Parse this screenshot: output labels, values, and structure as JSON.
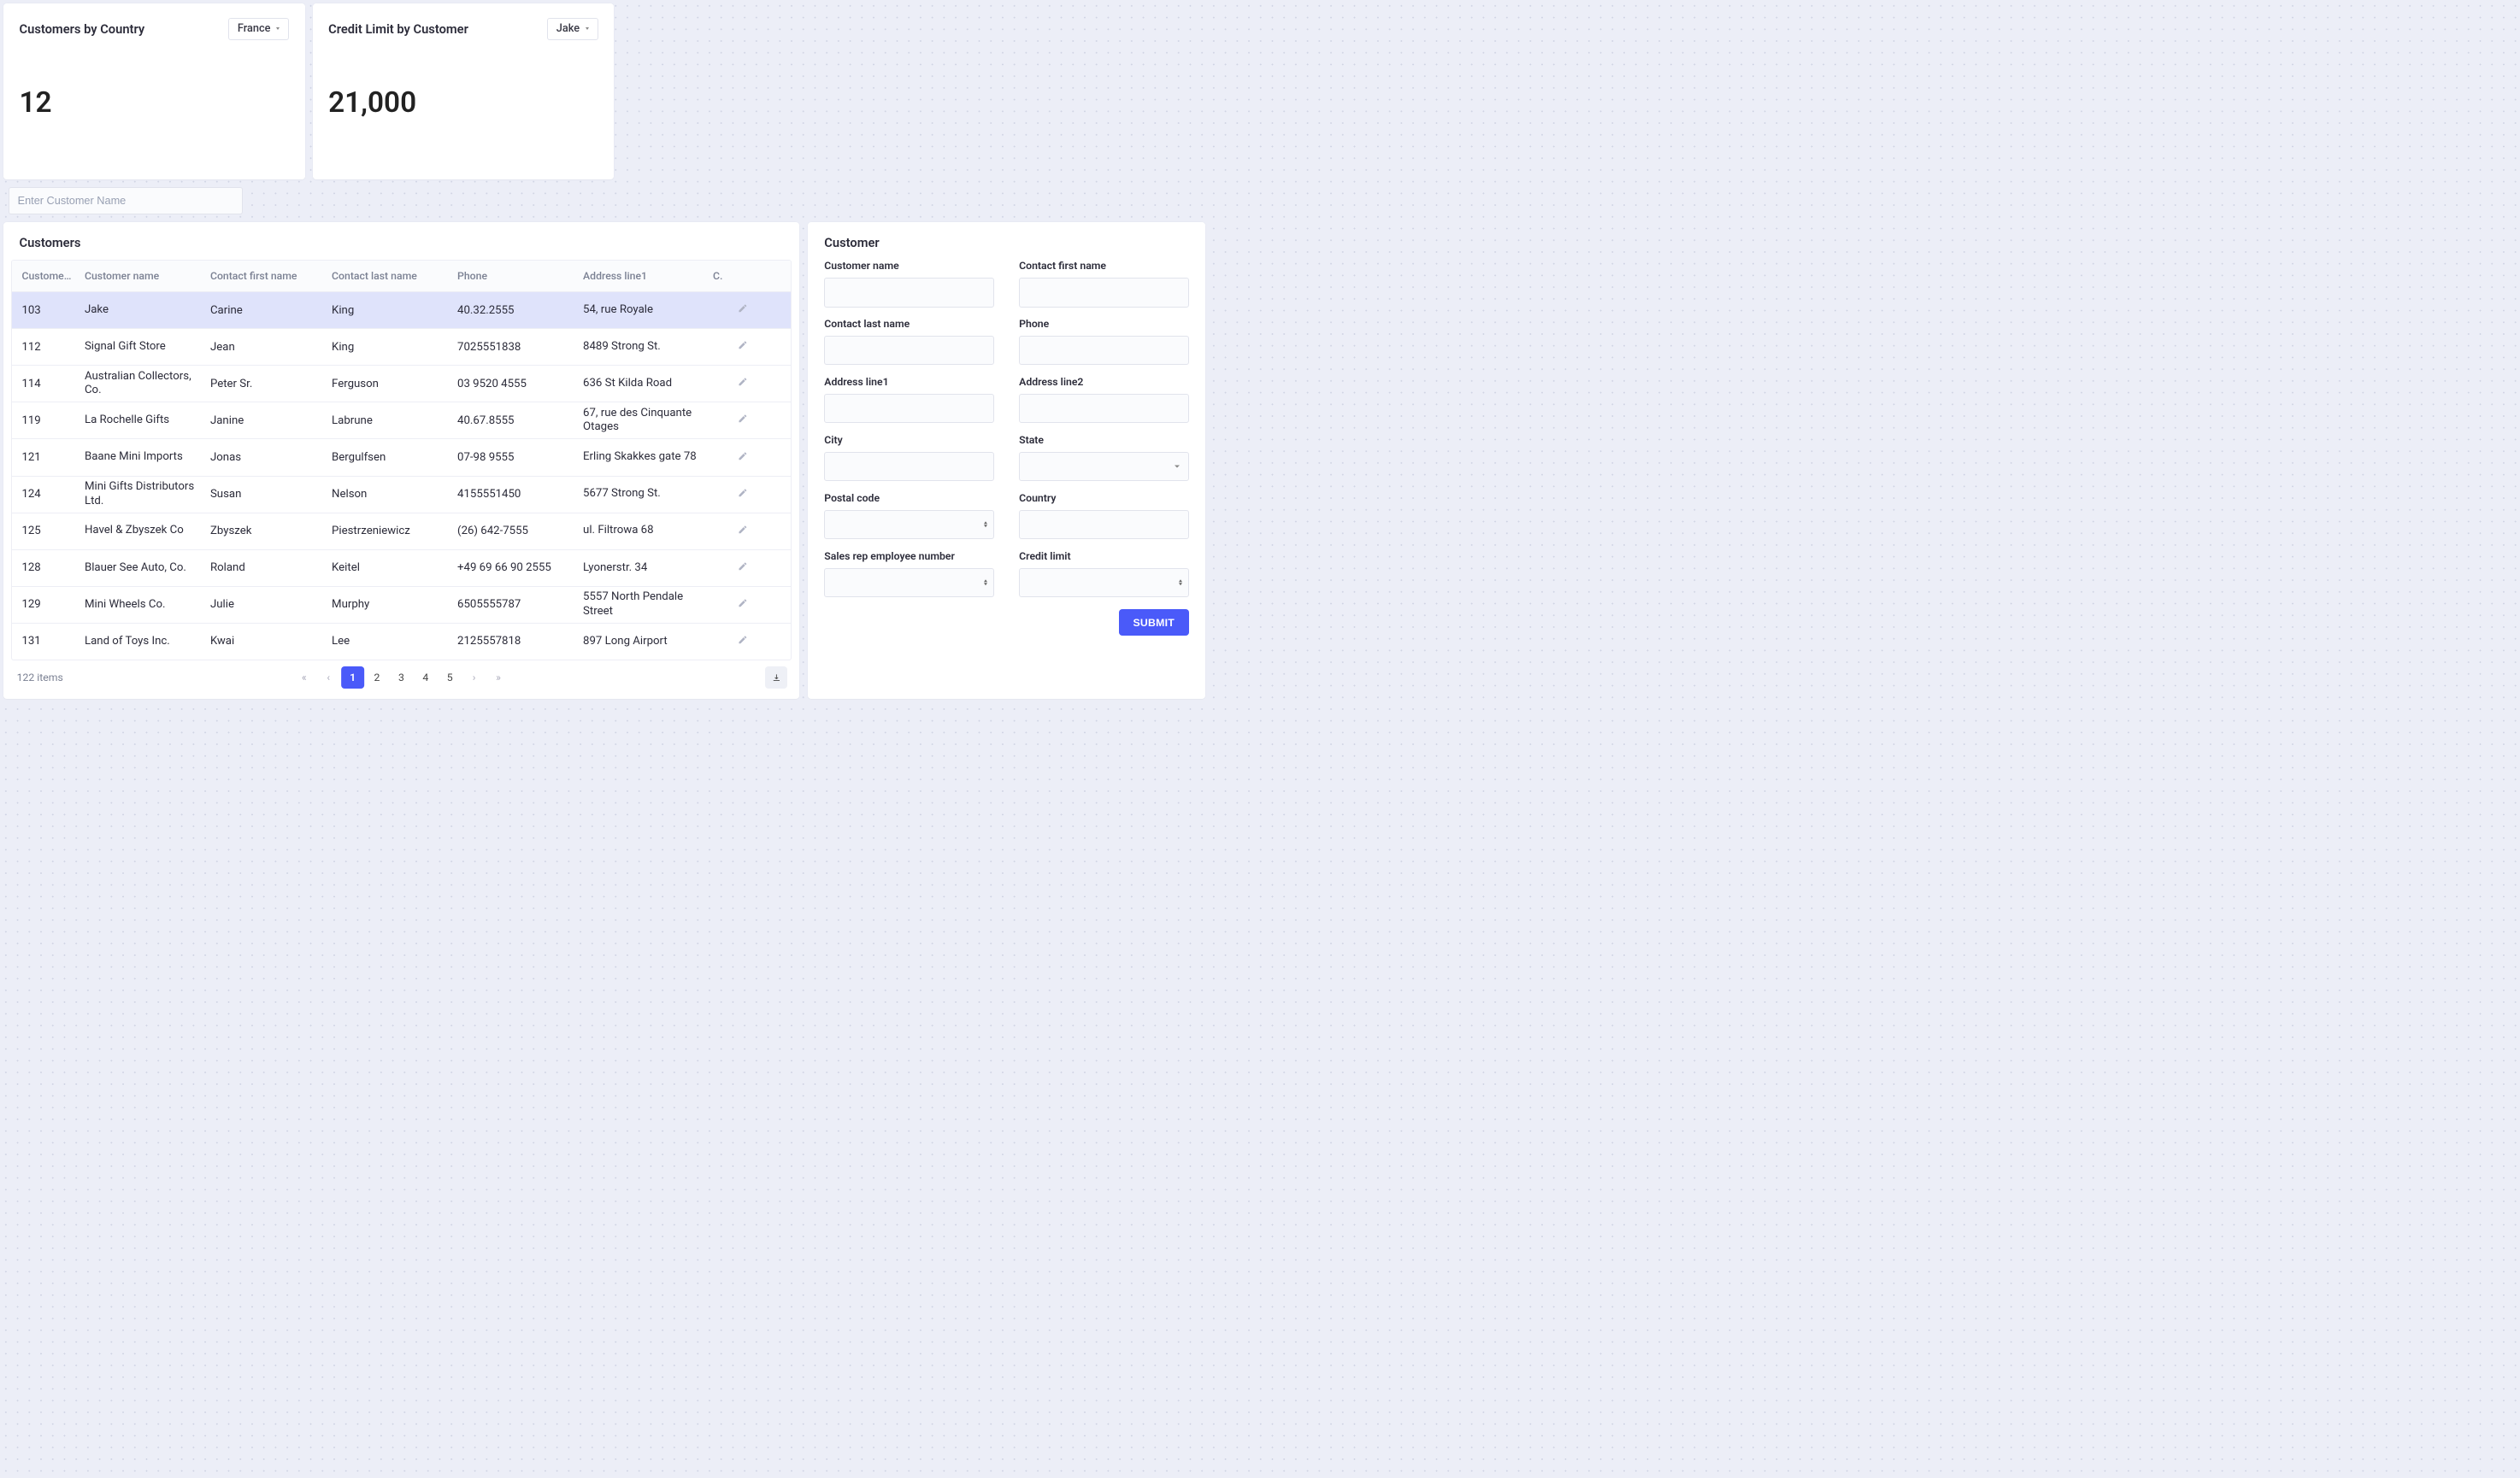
{
  "metrics": {
    "customers_by_country": {
      "title": "Customers by Country",
      "selected": "France",
      "value": "12"
    },
    "credit_limit_by_customer": {
      "title": "Credit Limit by Customer",
      "selected": "Jake",
      "value": "21,000"
    }
  },
  "search": {
    "placeholder": "Enter Customer Name"
  },
  "customers_table": {
    "title": "Customers",
    "headers": {
      "number": "Customer…",
      "name": "Customer name",
      "first": "Contact first name",
      "last": "Contact last name",
      "phone": "Phone",
      "addr1": "Address line1",
      "extra": "C"
    },
    "rows": [
      {
        "num": "103",
        "name": "Jake",
        "first": "Carine",
        "last": "King",
        "phone": "40.32.2555",
        "addr1": "54, rue Royale",
        "selected": true
      },
      {
        "num": "112",
        "name": "Signal Gift Store",
        "first": "Jean",
        "last": "King",
        "phone": "7025551838",
        "addr1": "8489 Strong St."
      },
      {
        "num": "114",
        "name": "Australian Collectors, Co.",
        "first": "Peter Sr.",
        "last": "Ferguson",
        "phone": "03 9520 4555",
        "addr1": "636 St Kilda Road"
      },
      {
        "num": "119",
        "name": "La Rochelle Gifts",
        "first": "Janine",
        "last": "Labrune",
        "phone": "40.67.8555",
        "addr1": "67, rue des Cinquante Otages"
      },
      {
        "num": "121",
        "name": "Baane Mini Imports",
        "first": "Jonas",
        "last": "Bergulfsen",
        "phone": "07-98 9555",
        "addr1": "Erling Skakkes gate 78"
      },
      {
        "num": "124",
        "name": "Mini Gifts Distributors Ltd.",
        "first": "Susan",
        "last": "Nelson",
        "phone": "4155551450",
        "addr1": "5677 Strong St."
      },
      {
        "num": "125",
        "name": "Havel & Zbyszek Co",
        "first": "Zbyszek",
        "last": "Piestrzeniewicz",
        "phone": "(26) 642-7555",
        "addr1": "ul. Filtrowa 68"
      },
      {
        "num": "128",
        "name": "Blauer See Auto, Co.",
        "first": "Roland",
        "last": "Keitel",
        "phone": "+49 69 66 90 2555",
        "addr1": "Lyonerstr. 34"
      },
      {
        "num": "129",
        "name": "Mini Wheels Co.",
        "first": "Julie",
        "last": "Murphy",
        "phone": "6505555787",
        "addr1": "5557 North Pendale Street"
      },
      {
        "num": "131",
        "name": "Land of Toys Inc.",
        "first": "Kwai",
        "last": "Lee",
        "phone": "2125557818",
        "addr1": "897 Long Airport"
      }
    ],
    "footer": {
      "count": "122 items",
      "pages": [
        "1",
        "2",
        "3",
        "4",
        "5"
      ],
      "active_page": "1"
    }
  },
  "customer_form": {
    "title": "Customer",
    "fields": {
      "customer_name": "Customer name",
      "contact_first_name": "Contact first name",
      "contact_last_name": "Contact last name",
      "phone": "Phone",
      "address_line1": "Address line1",
      "address_line2": "Address line2",
      "city": "City",
      "state": "State",
      "postal_code": "Postal code",
      "country": "Country",
      "sales_rep": "Sales rep employee number",
      "credit_limit": "Credit limit"
    },
    "submit_label": "SUBMIT"
  }
}
